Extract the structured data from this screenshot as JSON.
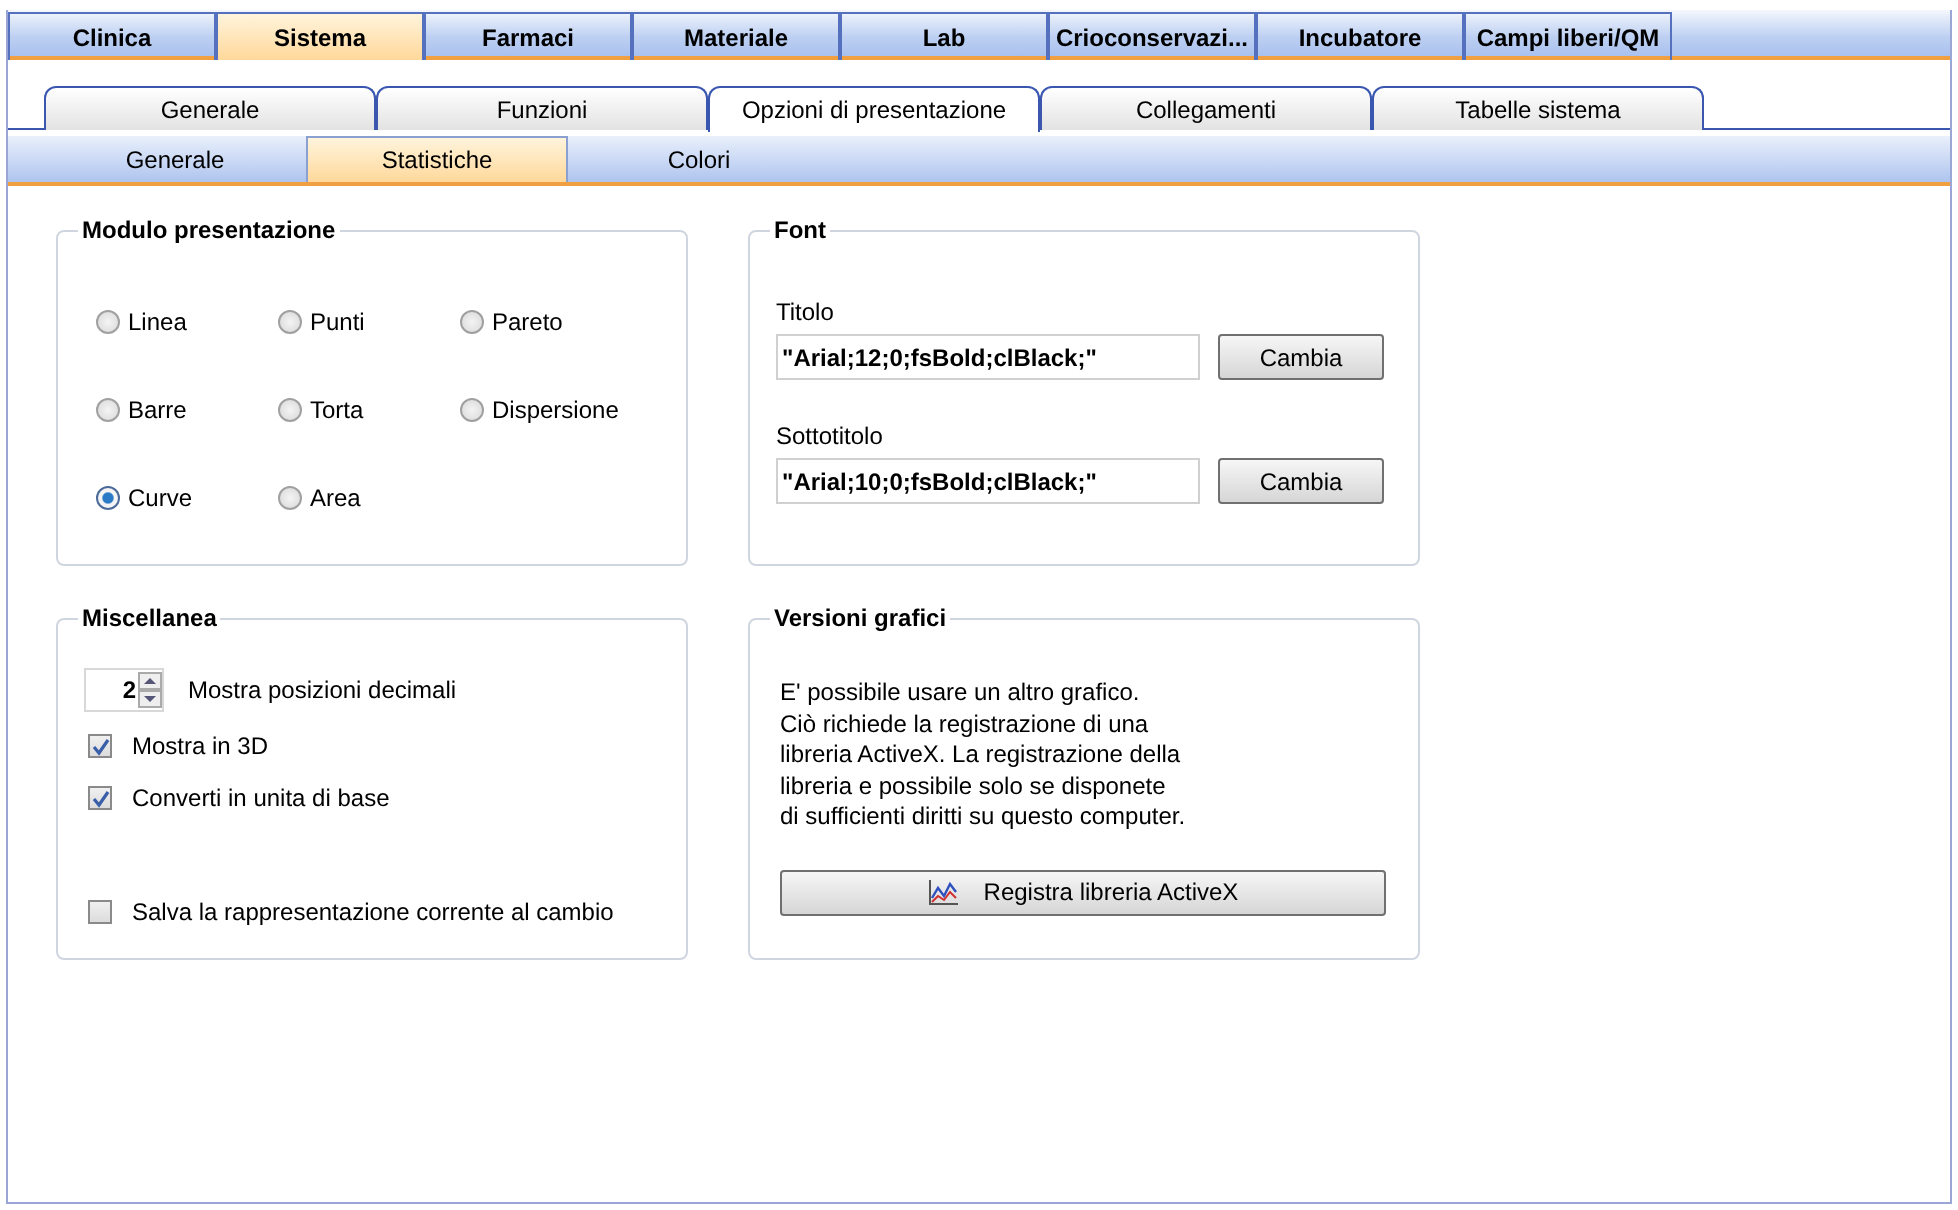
{
  "main_tabs": [
    {
      "label": "Clinica",
      "selected": false
    },
    {
      "label": "Sistema",
      "selected": true
    },
    {
      "label": "Farmaci",
      "selected": false
    },
    {
      "label": "Materiale",
      "selected": false
    },
    {
      "label": "Lab",
      "selected": false
    },
    {
      "label": "Crioconservazi...",
      "selected": false
    },
    {
      "label": "Incubatore",
      "selected": false
    },
    {
      "label": "Campi liberi/QM",
      "selected": false
    }
  ],
  "sub_tabs": [
    {
      "label": "Generale",
      "selected": false
    },
    {
      "label": "Funzioni",
      "selected": false
    },
    {
      "label": "Opzioni di presentazione",
      "selected": true
    },
    {
      "label": "Collegamenti",
      "selected": false
    },
    {
      "label": "Tabelle sistema",
      "selected": false
    }
  ],
  "inner_tabs": [
    {
      "label": "Generale",
      "selected": false
    },
    {
      "label": "Statistiche",
      "selected": true
    },
    {
      "label": "Colori",
      "selected": false
    }
  ],
  "presentation_module": {
    "title": "Modulo presentazione",
    "options": [
      {
        "label": "Linea",
        "selected": false
      },
      {
        "label": "Punti",
        "selected": false
      },
      {
        "label": "Pareto",
        "selected": false
      },
      {
        "label": "Barre",
        "selected": false
      },
      {
        "label": "Torta",
        "selected": false
      },
      {
        "label": "Dispersione",
        "selected": false
      },
      {
        "label": "Curve",
        "selected": true
      },
      {
        "label": "Area",
        "selected": false
      }
    ]
  },
  "font": {
    "title": "Font",
    "fields": [
      {
        "label": "Titolo",
        "value": "\"Arial;12;0;fsBold;clBlack;\"",
        "button": "Cambia"
      },
      {
        "label": "Sottotitolo",
        "value": "\"Arial;10;0;fsBold;clBlack;\"",
        "button": "Cambia"
      }
    ]
  },
  "misc": {
    "title": "Miscellanea",
    "decimals": {
      "value": "2",
      "label": "Mostra posizioni decimali"
    },
    "checkboxes": [
      {
        "label": "Mostra in 3D",
        "checked": true
      },
      {
        "label": "Converti in unita di base",
        "checked": true
      },
      {
        "label": "Salva la rappresentazione corrente al cambio",
        "checked": false
      }
    ]
  },
  "chart_versions": {
    "title": "Versioni grafici",
    "text": "E' possibile usare un altro grafico.\nCiò richiede la registrazione di una\nlibreria ActiveX. La registrazione della\nlibreria e possibile solo se disponete\ndi sufficienti diritti su questo computer.",
    "button": "Registra libreria ActiveX"
  }
}
